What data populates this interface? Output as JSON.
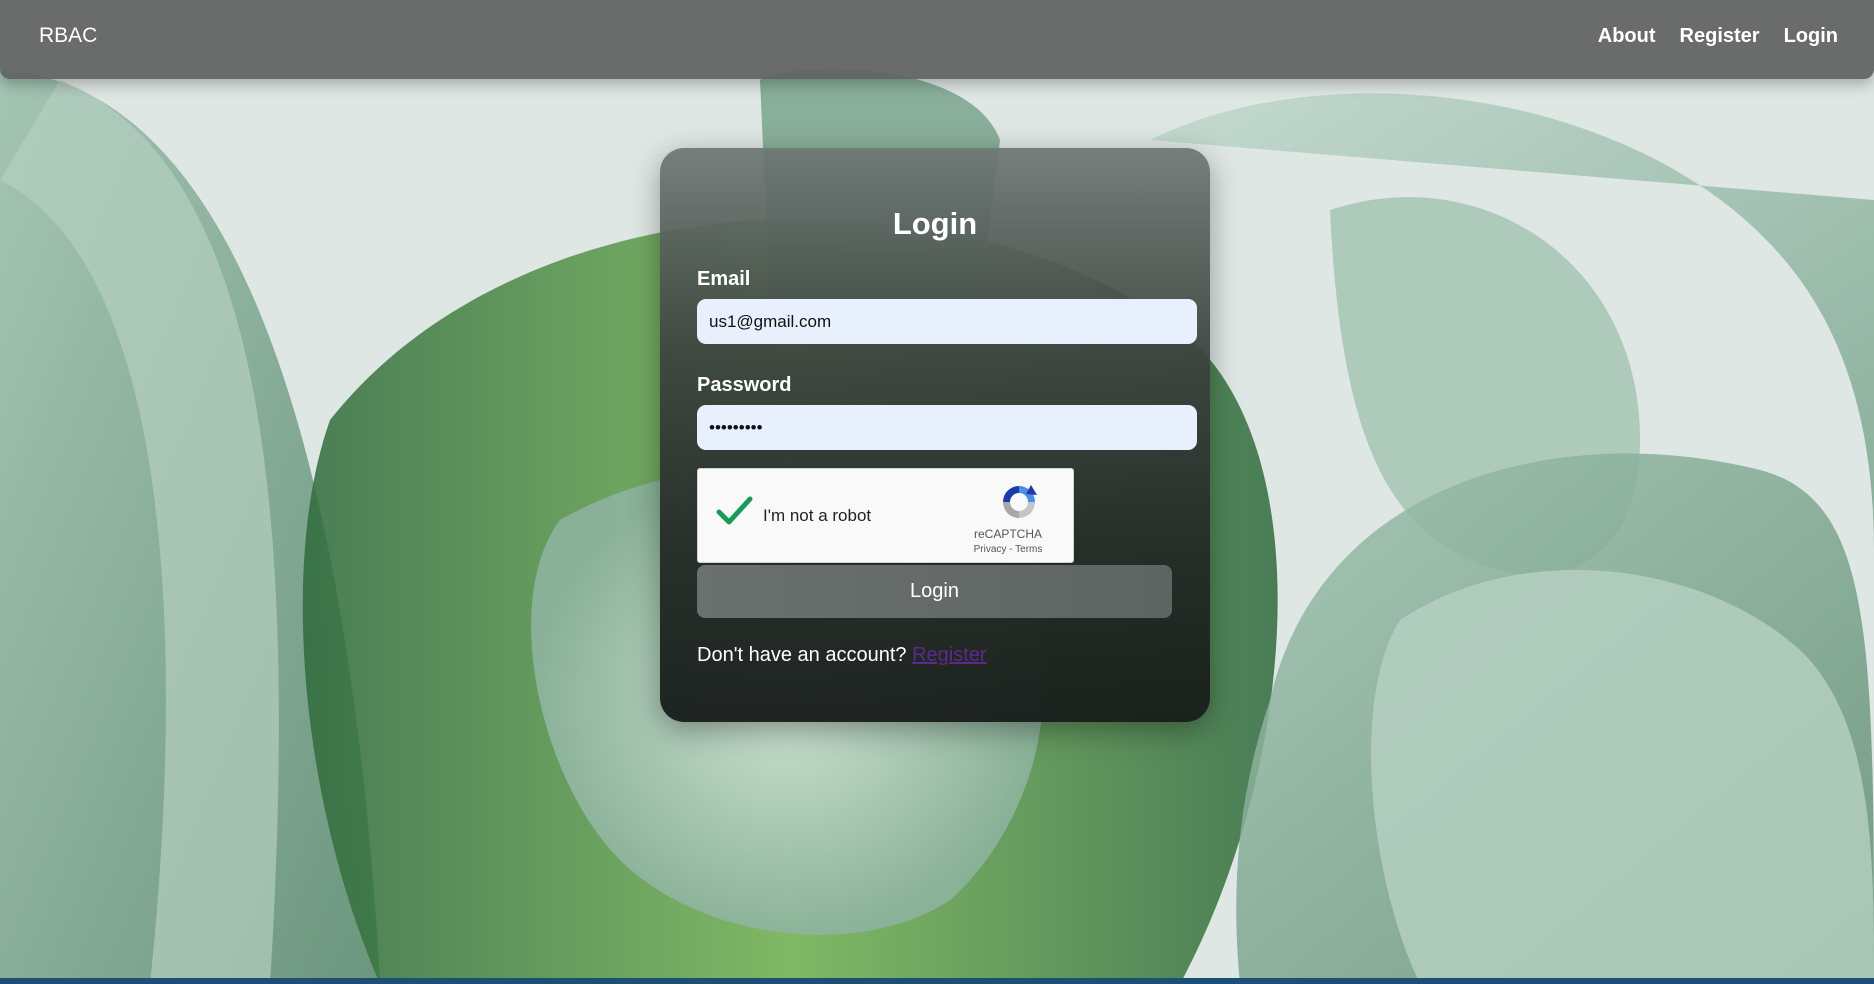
{
  "navbar": {
    "brand": "RBAC",
    "links": [
      {
        "label": "About"
      },
      {
        "label": "Register"
      },
      {
        "label": "Login"
      }
    ]
  },
  "login_form": {
    "title": "Login",
    "email_label": "Email",
    "email_value": "us1@gmail.com",
    "password_label": "Password",
    "password_value": "•••••••••",
    "captcha": {
      "checked": true,
      "label": "I'm not a robot",
      "brand": "reCAPTCHA",
      "privacy_label": "Privacy",
      "separator": " - ",
      "terms_label": "Terms"
    },
    "submit_label": "Login",
    "register_prompt": "Don't have an account?",
    "register_link_label": "Register"
  },
  "colors": {
    "navbar_bg": "#5f6161",
    "input_bg": "#e8effd",
    "check_green": "#1a9a57",
    "register_link": "#5b2a8e",
    "bottom_strip": "#1d4f74"
  },
  "icons": {
    "captcha_check": "checkmark-icon",
    "captcha_logo": "recaptcha-logo-icon"
  }
}
